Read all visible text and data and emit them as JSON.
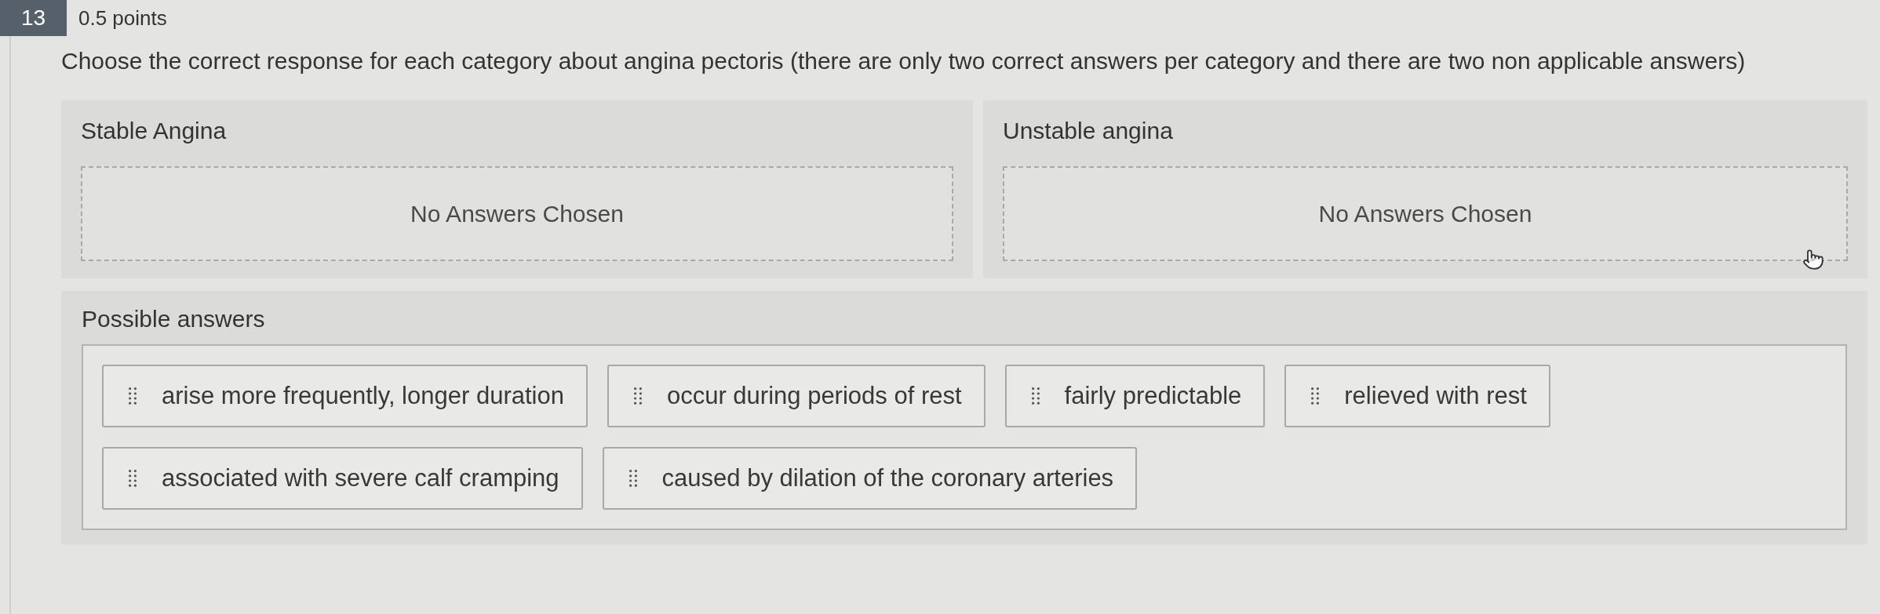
{
  "question": {
    "number": "13",
    "points": "0.5 points",
    "prompt": "Choose the correct response for each category about angina pectoris (there are only two correct answers per category and there are two non applicable answers)"
  },
  "categories": [
    {
      "title": "Stable Angina",
      "empty_text": "No Answers Chosen"
    },
    {
      "title": "Unstable angina",
      "empty_text": "No Answers Chosen"
    }
  ],
  "possible_answers": {
    "title": "Possible answers",
    "items": [
      "arise more frequently, longer duration",
      "occur during periods of rest",
      "fairly predictable",
      "relieved with rest",
      "associated with severe calf cramping",
      "caused by dilation of the coronary arteries"
    ]
  }
}
